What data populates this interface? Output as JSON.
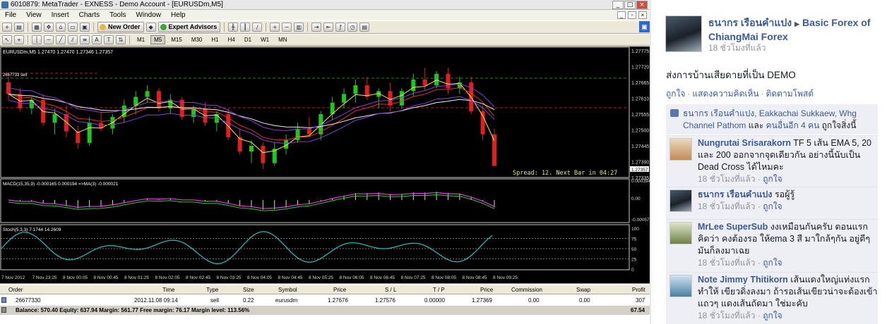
{
  "window": {
    "title": "6010879: MetaTrader - EXNESS - Demo Account - [EURUSDm,M5]",
    "menu": [
      "File",
      "View",
      "Insert",
      "Charts",
      "Tools",
      "Window",
      "Help"
    ],
    "mdi_buttons": [
      "_",
      "▫",
      "×"
    ],
    "toolbar": {
      "new_order": "New Order",
      "expert_advisors": "Expert Advisors"
    },
    "timeframes": [
      "M1",
      "M5",
      "M15",
      "M30",
      "H1",
      "H4",
      "D1",
      "W1",
      "MN"
    ],
    "active_timeframe": "M5"
  },
  "chart": {
    "symbol_header": "EURUSDm,M5  1.27470 1.27470 1.27346 1.27357",
    "bid_line_label": "2667733 sell",
    "spread_text": "Spread: 12. Next Bar in 04:27",
    "current_price": "1.27357",
    "bid_price_box": "1.27369",
    "price_axis": [
      "1.27775",
      "1.27720",
      "1.27665",
      "1.27610",
      "1.27555",
      "1.27500",
      "1.27445",
      "1.27390",
      "1.27335"
    ],
    "macd_label": "MACD(15,35,9) -0.000165 0.000194 =>MA(3) -0.000021",
    "macd_axis": [
      "0.000394",
      "0.00",
      "-0.00057"
    ],
    "stoch_label": "Stoch(5,3,3) 7.1744 14.2609",
    "stoch_axis": [
      "100",
      "75",
      "50",
      "25",
      "0"
    ],
    "time_axis": [
      "7 Nov 2012",
      "7 Nov 23:25",
      "8 Nov 00:05",
      "8 Nov 00:45",
      "8 Nov 01:25",
      "8 Nov 02:05",
      "8 Nov 02:45",
      "8 Nov 03:25",
      "8 Nov 04:05",
      "8 Nov 04:45",
      "8 Nov 05:25",
      "8 Nov 06:05",
      "8 Nov 06:45",
      "8 Nov 07:25",
      "8 Nov 08:05",
      "8 Nov 08:45",
      "8 Nov 09:25"
    ]
  },
  "chart_data": {
    "type": "candlestick",
    "title": "EURUSDm,M5",
    "ylim": [
      1.27335,
      1.27775
    ],
    "candles": [
      [
        1.2766,
        1.2768,
        1.276,
        1.2762
      ],
      [
        1.2762,
        1.2764,
        1.2756,
        1.2757
      ],
      [
        1.2757,
        1.2761,
        1.2755,
        1.276
      ],
      [
        1.276,
        1.2762,
        1.2751,
        1.2752
      ],
      [
        1.2752,
        1.2757,
        1.2748,
        1.2755
      ],
      [
        1.2755,
        1.2758,
        1.2747,
        1.2749
      ],
      [
        1.2749,
        1.2751,
        1.2743,
        1.2745
      ],
      [
        1.2745,
        1.2754,
        1.2744,
        1.2752
      ],
      [
        1.2752,
        1.2756,
        1.2749,
        1.275
      ],
      [
        1.275,
        1.2755,
        1.2748,
        1.2754
      ],
      [
        1.2754,
        1.276,
        1.2752,
        1.2758
      ],
      [
        1.2758,
        1.2763,
        1.2755,
        1.2761
      ],
      [
        1.2761,
        1.2765,
        1.2759,
        1.2763
      ],
      [
        1.2763,
        1.2764,
        1.2756,
        1.2757
      ],
      [
        1.2757,
        1.2762,
        1.2755,
        1.276
      ],
      [
        1.276,
        1.2761,
        1.2753,
        1.2754
      ],
      [
        1.2754,
        1.2758,
        1.2752,
        1.2757
      ],
      [
        1.2757,
        1.2759,
        1.2751,
        1.2752
      ],
      [
        1.2752,
        1.2756,
        1.2749,
        1.2755
      ],
      [
        1.2755,
        1.2757,
        1.2746,
        1.2747
      ],
      [
        1.2747,
        1.275,
        1.2741,
        1.2742
      ],
      [
        1.2742,
        1.2746,
        1.2738,
        1.2744
      ],
      [
        1.2744,
        1.2745,
        1.2736,
        1.2738
      ],
      [
        1.2738,
        1.2745,
        1.2737,
        1.2743
      ],
      [
        1.2743,
        1.2748,
        1.2741,
        1.2746
      ],
      [
        1.2746,
        1.2752,
        1.2745,
        1.275
      ],
      [
        1.275,
        1.2754,
        1.2747,
        1.2748
      ],
      [
        1.2748,
        1.2756,
        1.2746,
        1.2755
      ],
      [
        1.2755,
        1.2761,
        1.2753,
        1.2759
      ],
      [
        1.2759,
        1.2764,
        1.2757,
        1.2762
      ],
      [
        1.2762,
        1.2767,
        1.2759,
        1.2765
      ],
      [
        1.2765,
        1.2768,
        1.276,
        1.2761
      ],
      [
        1.2761,
        1.2764,
        1.2757,
        1.2763
      ],
      [
        1.2763,
        1.2766,
        1.2756,
        1.2758
      ],
      [
        1.2758,
        1.2764,
        1.2757,
        1.2763
      ],
      [
        1.2763,
        1.2769,
        1.2761,
        1.2767
      ],
      [
        1.2767,
        1.2771,
        1.2763,
        1.2765
      ],
      [
        1.2765,
        1.277,
        1.2764,
        1.2769
      ],
      [
        1.2769,
        1.2771,
        1.2762,
        1.2764
      ],
      [
        1.2764,
        1.2768,
        1.2762,
        1.2766
      ],
      [
        1.2766,
        1.2768,
        1.2755,
        1.2756
      ],
      [
        1.2756,
        1.2758,
        1.2746,
        1.2748
      ],
      [
        1.2748,
        1.275,
        1.2741,
        1.2737
      ]
    ]
  },
  "terminal": {
    "headers": [
      "Order",
      "Time",
      "Type",
      "Size",
      "Symbol",
      "Price",
      "S / L",
      "T / P",
      "Price",
      "Commission",
      "Swap",
      "Profit"
    ],
    "rows": [
      [
        "26677330",
        "2012.11.08 09:14",
        "sell",
        "0.22",
        "eurusdm",
        "1.27676",
        "1.27576",
        "0.00000",
        "1.27369",
        "0.00",
        "0.00",
        "307"
      ]
    ],
    "balance_line": "Balance: 570.40  Equity: 637.94  Margin: 561.77  Free margin: 76.17  Margin level: 113.56%",
    "balance_profit": "67.54"
  },
  "facebook": {
    "author": "ธนากร เรือนคำแปง",
    "group": "Basic Forex of ChiangMai Forex",
    "time": "18 ชั่วโมงที่แล้ว",
    "text": "ส่งการบ้านเสียดายที่เป็น DEMO",
    "actions": [
      "ถูกใจ",
      "แสดงความคิดเห็น",
      "ติดตามโพสต์"
    ],
    "likes": {
      "names": "ธนากร เรือนคำแปง, Eakkachai Sukkaew, Whg Channel Pathom",
      "joiner": "และ",
      "others": "คนอื่นอีก 4 คน",
      "suffix": "ถูกใจสิ่งนี้"
    },
    "comments": [
      {
        "name": "Nungrutai Srisarakorn",
        "text": "TF 5 เส้น EMA 5, 20 และ 200 ออกจากจุดเดียวกัน อย่างนี้นับเป็น Dead Cross ได้ไหมคะ",
        "time": "18 ชั่วโมงที่แล้ว",
        "like": "ถูกใจ"
      },
      {
        "name": "ธนากร เรือนคำแปง",
        "text": "รอผู้รู้",
        "time": "18 ชั่วโมงที่แล้ว",
        "like": "ถูกใจ"
      },
      {
        "name": "MrLee SuperSub",
        "text": "งงเหมือนกันครับ ตอนแรกคิดว่า คงต้องรอ ให้ema 3 สี มาใกล้ๆกัน อยู่ดีๆ มันก็ลงมาเฉย",
        "time": "18 ชั่วโมงที่แล้ว",
        "like": "ถูกใจ"
      },
      {
        "name": "Note Jimmy Thitikorn",
        "text": "เส้นแดงใหญ่แท่งแรกทำให้ เขียวดิ่งลงมา ถ้ารอเส้นเขียวน่าจะต้องเข้าแถวๆ แดงเส้นถัดมา ใช่มะคับ",
        "time": "18 ชั่วโมงที่แล้ว",
        "like": "ถูกใจ"
      }
    ]
  }
}
